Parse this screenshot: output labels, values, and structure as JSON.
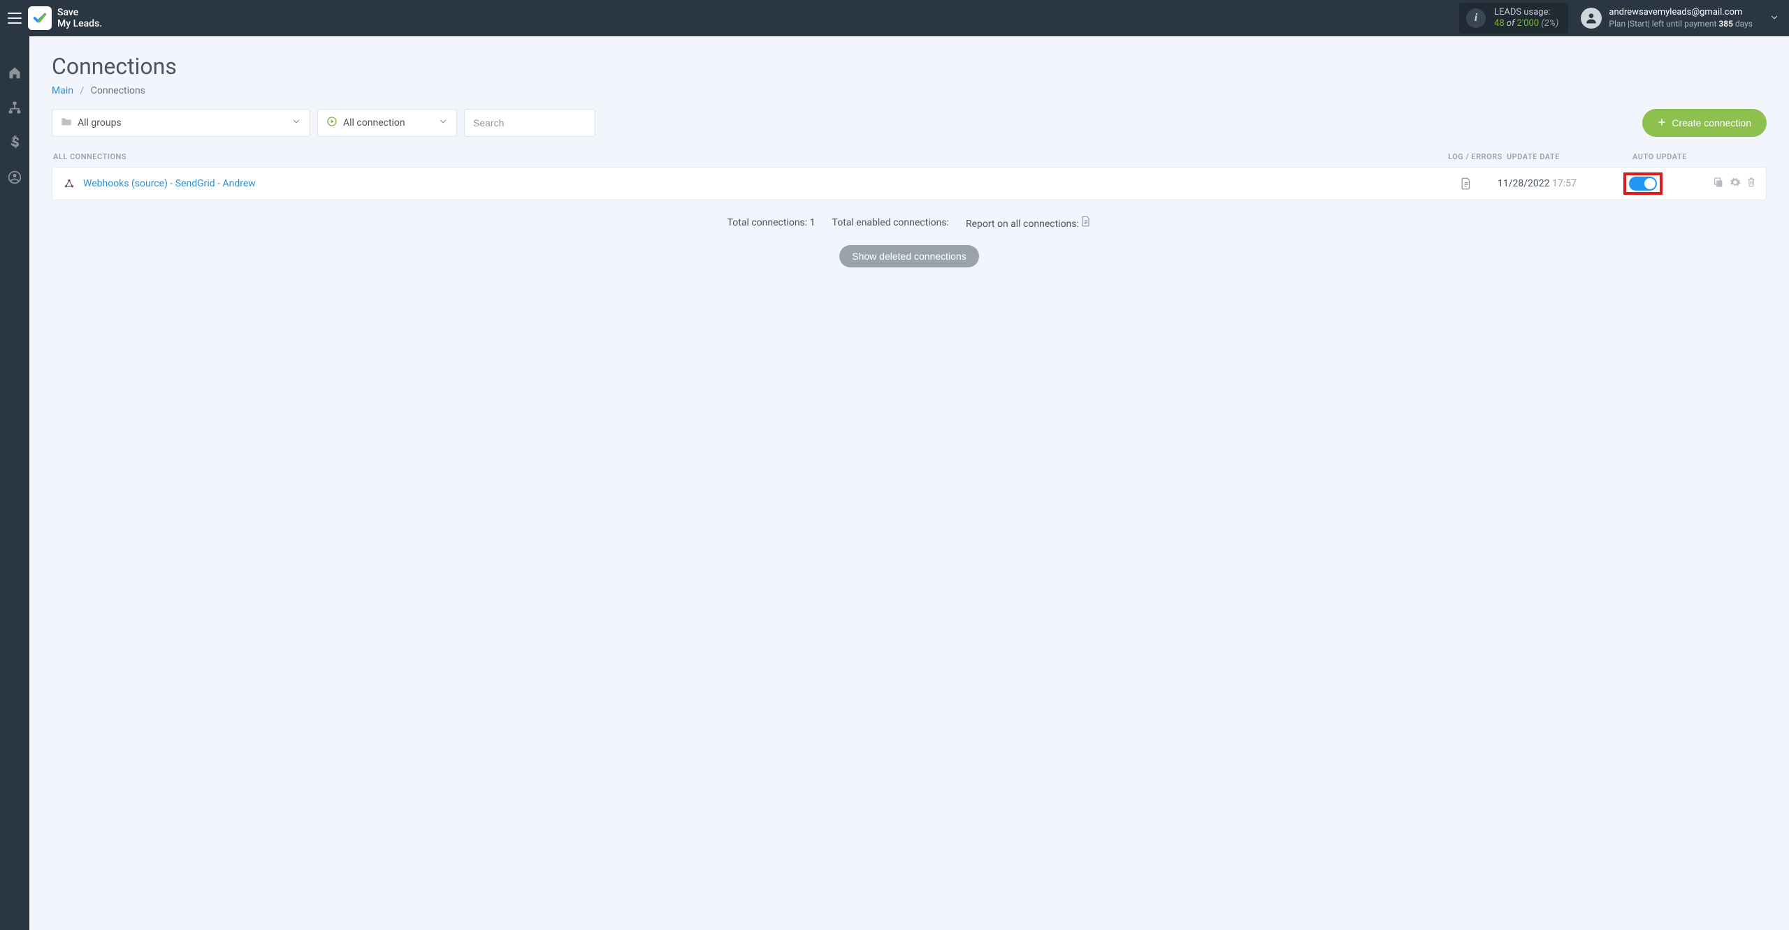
{
  "brand": {
    "line1": "Save",
    "line2": "My Leads."
  },
  "usage": {
    "label": "LEADS usage:",
    "used": "48",
    "of_word": "of",
    "total": "2'000",
    "pct": "(2%)"
  },
  "user": {
    "email": "andrewsavemyleads@gmail.com",
    "plan_prefix": "Plan |Start| left until payment ",
    "plan_days_num": "385",
    "plan_days_suffix": " days"
  },
  "page": {
    "title": "Connections",
    "breadcrumb_main": "Main",
    "breadcrumb_current": "Connections"
  },
  "controls": {
    "groups_label": "All groups",
    "status_label": "All connection",
    "search_placeholder": "Search",
    "create_label": "Create connection"
  },
  "table": {
    "head_all": "All connections",
    "head_log": "Log / Errors",
    "head_date": "Update date",
    "head_auto": "Auto update",
    "row": {
      "name": "Webhooks (source) - SendGrid - Andrew",
      "date": "11/28/2022",
      "time": "17:57"
    }
  },
  "summary": {
    "total_label": "Total connections: ",
    "total_value": "1",
    "enabled_label": "Total enabled connections:",
    "report_label": "Report on all connections:"
  },
  "show_deleted": "Show deleted connections"
}
